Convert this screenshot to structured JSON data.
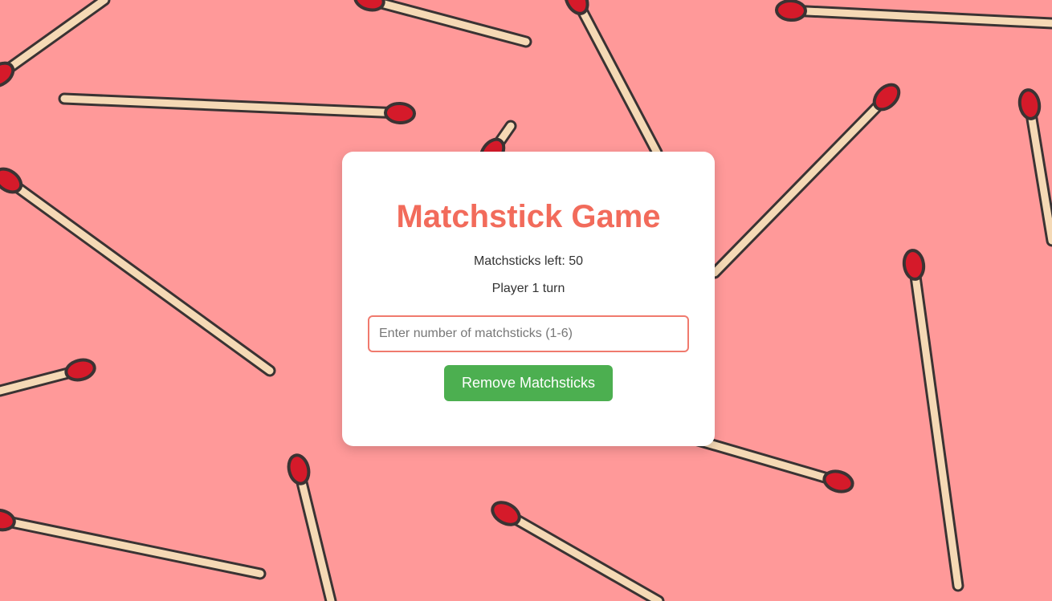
{
  "game": {
    "title": "Matchstick Game",
    "matchsticks_left_label": "Matchsticks left: 50",
    "turn_label": "Player 1 turn",
    "matchsticks_left": 50,
    "current_player": 1
  },
  "input": {
    "placeholder": "Enter number of matchsticks (1-6)",
    "value": ""
  },
  "button": {
    "label": "Remove Matchsticks"
  },
  "colors": {
    "background": "#FF9999",
    "title": "#F26B5B",
    "input_border": "#F07A6E",
    "button": "#4CAF50",
    "match_stick": "#F5D9B5",
    "match_head": "#D51A2A",
    "outline": "#3A3333"
  },
  "background_pattern": {
    "type": "matchsticks",
    "icon": "matchstick-icon"
  }
}
